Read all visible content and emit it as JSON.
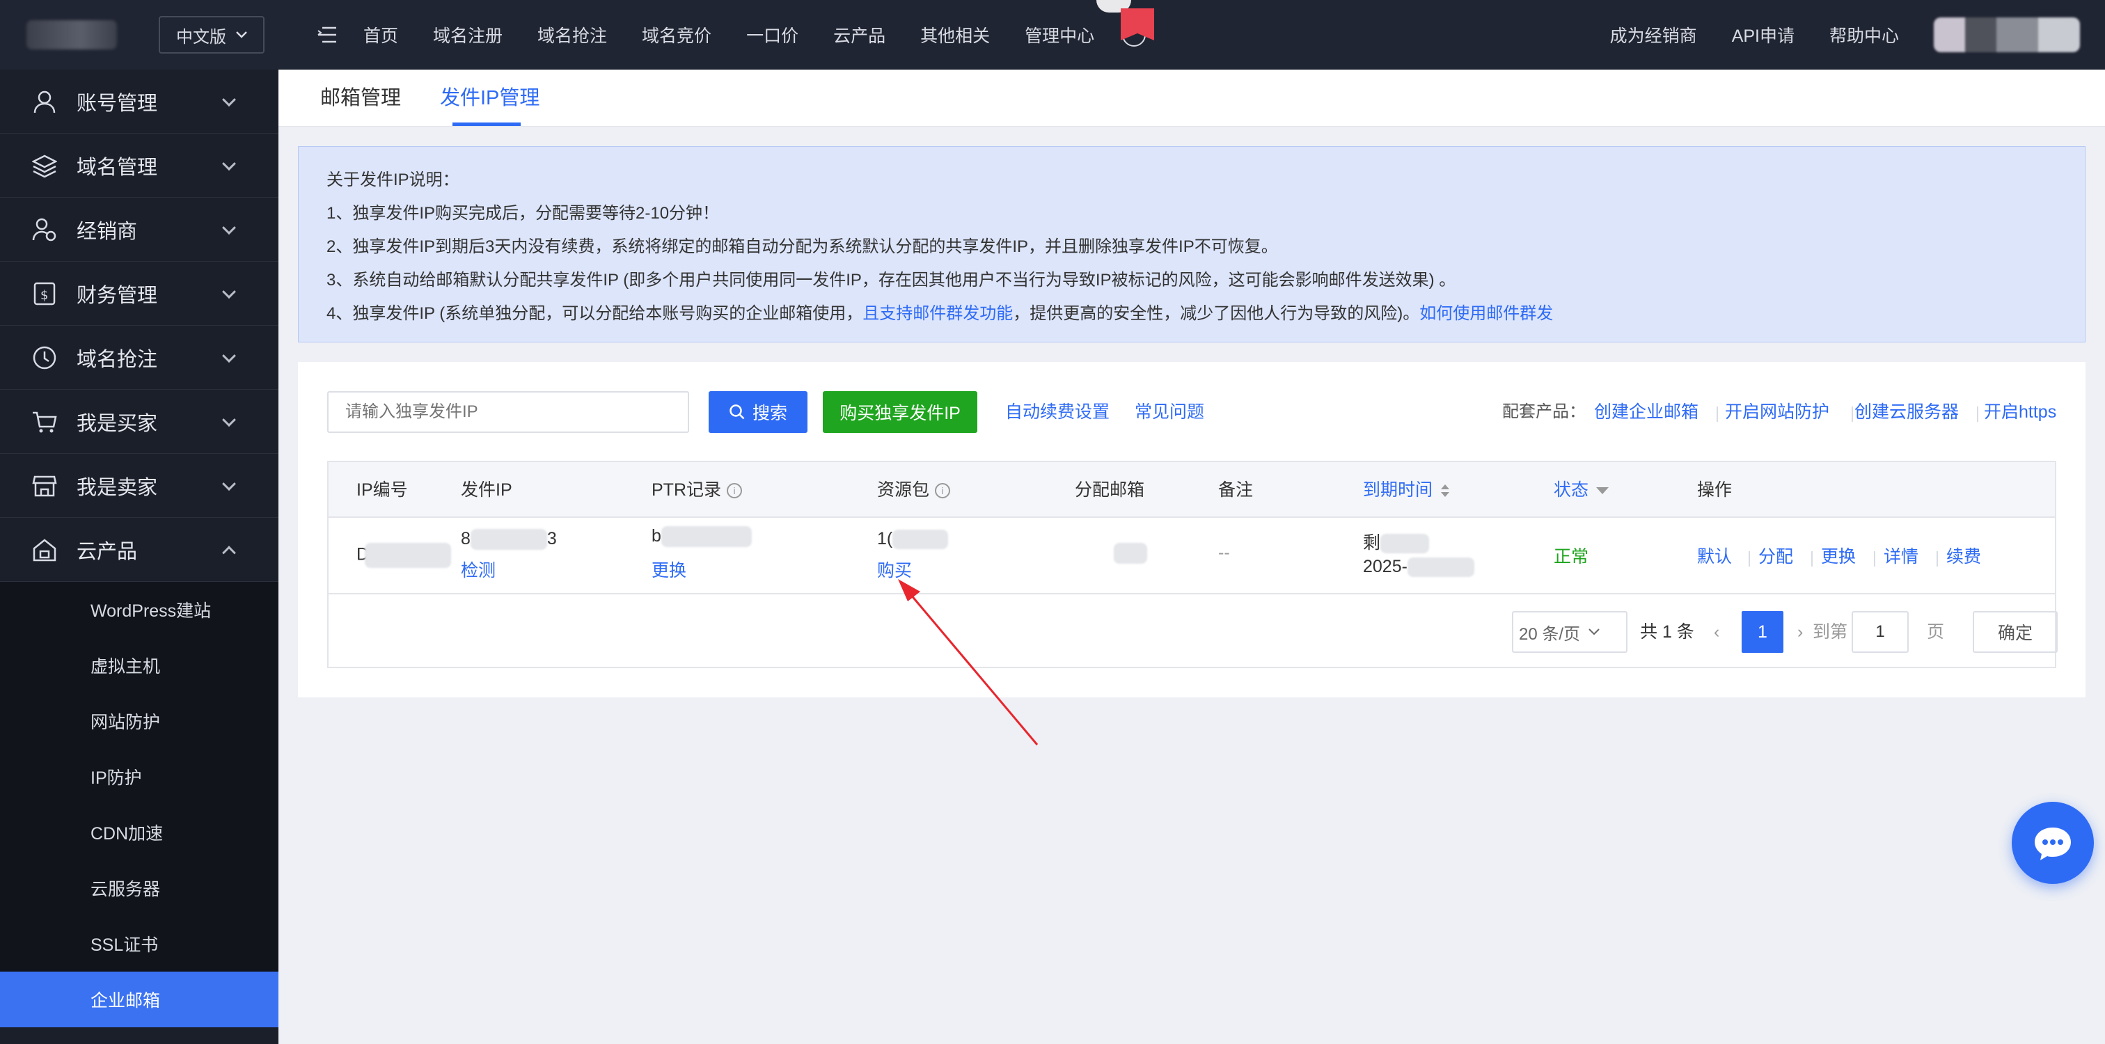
{
  "header": {
    "lang_label": "中文版",
    "nav": [
      "首页",
      "域名注册",
      "域名抢注",
      "域名竞价",
      "一口价",
      "云产品",
      "其他相关",
      "管理中心"
    ],
    "right_links": [
      "成为经销商",
      "API申请",
      "帮助中心"
    ]
  },
  "sidebar": {
    "items": [
      {
        "label": "账号管理",
        "icon": "user-icon"
      },
      {
        "label": "域名管理",
        "icon": "layers-icon"
      },
      {
        "label": "经销商",
        "icon": "reseller-icon"
      },
      {
        "label": "财务管理",
        "icon": "finance-icon"
      },
      {
        "label": "域名抢注",
        "icon": "clock-icon"
      },
      {
        "label": "我是买家",
        "icon": "cart-icon"
      },
      {
        "label": "我是卖家",
        "icon": "store-icon"
      },
      {
        "label": "云产品",
        "icon": "cloud-home-icon"
      }
    ],
    "sub_items": [
      "WordPress建站",
      "虚拟主机",
      "网站防护",
      "IP防护",
      "CDN加速",
      "云服务器",
      "SSL证书",
      "企业邮箱"
    ]
  },
  "tabs": [
    "邮箱管理",
    "发件IP管理"
  ],
  "notice": {
    "title": "关于发件IP说明：",
    "line1": "1、独享发件IP购买完成后，分配需要等待2-10分钟！",
    "line2": "2、独享发件IP到期后3天内没有续费，系统将绑定的邮箱自动分配为系统默认分配的共享发件IP，并且删除独享发件IP不可恢复。",
    "line3": "3、系统自动给邮箱默认分配共享发件IP (即多个用户共同使用同一发件IP，存在因其他用户不当行为导致IP被标记的风险，这可能会影响邮件发送效果) 。",
    "line4_a": "4、独享发件IP (系统单独分配，可以分配给本账号购买的企业邮箱使用，",
    "line4_b": "且支持邮件群发功能",
    "line4_c": "，提供更高的安全性，减少了因他人行为导致的风险)。",
    "line4_link": "如何使用邮件群发"
  },
  "toolbar": {
    "search_placeholder": "请输入独享发件IP",
    "search_label": "搜索",
    "buy_label": "购买独享发件IP",
    "auto_renew": "自动续费设置",
    "faq": "常见问题",
    "related_label": "配套产品：",
    "related": [
      "创建企业邮箱",
      "开启网站防护",
      "创建云服务器",
      "开启https"
    ]
  },
  "table": {
    "headers": [
      "IP编号",
      "发件IP",
      "PTR记录",
      "资源包",
      "分配邮箱",
      "备注",
      "到期时间",
      "状态",
      "操作"
    ],
    "row": {
      "id": "D",
      "ip_a": "8",
      "ip_b": "3",
      "ip_action": "检测",
      "ptr": "b",
      "ptr_action": "更换",
      "package": "1(",
      "package_action": "购买",
      "remark": "--",
      "expire_a": "剩",
      "expire_b": "2025-",
      "status": "正常",
      "actions": [
        "默认",
        "分配",
        "更换",
        "详情",
        "续费"
      ]
    }
  },
  "pagination": {
    "page_size": "20 条/页",
    "total": "共 1 条",
    "current": "1",
    "goto_label": "到第",
    "goto_value": "1",
    "page_unit": "页",
    "confirm": "确定"
  },
  "colors": {
    "accent": "#2e6bf5",
    "buy_green": "#1fa51f",
    "status_ok": "#1fa51f",
    "topbar_bg": "#202533",
    "sidebar_bg": "#1b1f2a",
    "annotation_arrow": "#e8262d"
  }
}
